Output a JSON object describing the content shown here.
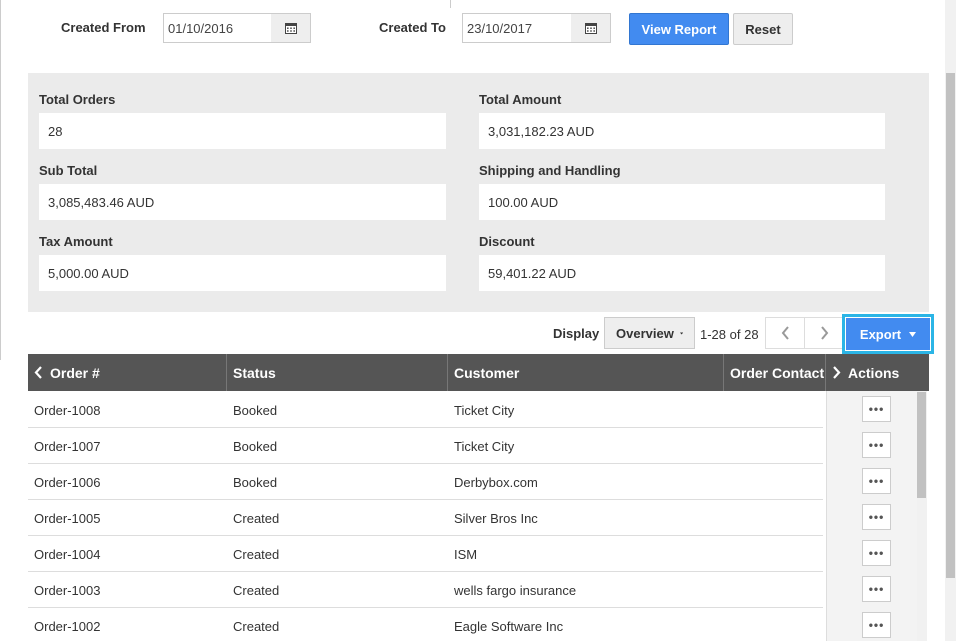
{
  "filters": {
    "created_from_label": "Created From",
    "created_from_value": "01/10/2016",
    "created_to_label": "Created To",
    "created_to_value": "23/10/2017",
    "view_report_label": "View Report",
    "reset_label": "Reset"
  },
  "summary": {
    "total_orders_label": "Total Orders",
    "total_orders_value": "28",
    "total_amount_label": "Total Amount",
    "total_amount_value": "3,031,182.23 AUD",
    "sub_total_label": "Sub Total",
    "sub_total_value": "3,085,483.46 AUD",
    "shipping_label": "Shipping and Handling",
    "shipping_value": "100.00 AUD",
    "tax_label": "Tax Amount",
    "tax_value": "5,000.00 AUD",
    "discount_label": "Discount",
    "discount_value": "59,401.22 AUD"
  },
  "toolbar": {
    "display_label": "Display",
    "display_value": "Overview",
    "page_range": "1-28 of 28",
    "export_label": "Export"
  },
  "table": {
    "headers": {
      "order": "Order #",
      "status": "Status",
      "customer": "Customer",
      "contact": "Order Contact",
      "actions": "Actions"
    },
    "rows": [
      {
        "order": "Order-1008",
        "status": "Booked",
        "customer": "Ticket City"
      },
      {
        "order": "Order-1007",
        "status": "Booked",
        "customer": "Ticket City"
      },
      {
        "order": "Order-1006",
        "status": "Booked",
        "customer": "Derbybox.com"
      },
      {
        "order": "Order-1005",
        "status": "Created",
        "customer": "Silver Bros Inc"
      },
      {
        "order": "Order-1004",
        "status": "Created",
        "customer": "ISM"
      },
      {
        "order": "Order-1003",
        "status": "Created",
        "customer": "wells fargo insurance"
      },
      {
        "order": "Order-1002",
        "status": "Created",
        "customer": "Eagle Software Inc"
      }
    ],
    "action_icon": "•••"
  },
  "icons": {
    "calendar": "calendar-icon",
    "chevron_left": "chevron-left-icon",
    "chevron_right": "chevron-right-icon",
    "caret_down": "caret-down-icon",
    "more": "more-horizontal-icon"
  },
  "colors": {
    "primary": "#428bf0",
    "header_bg": "#555555",
    "panel_bg": "#ebebeb",
    "highlight": "#2bb5e6"
  }
}
